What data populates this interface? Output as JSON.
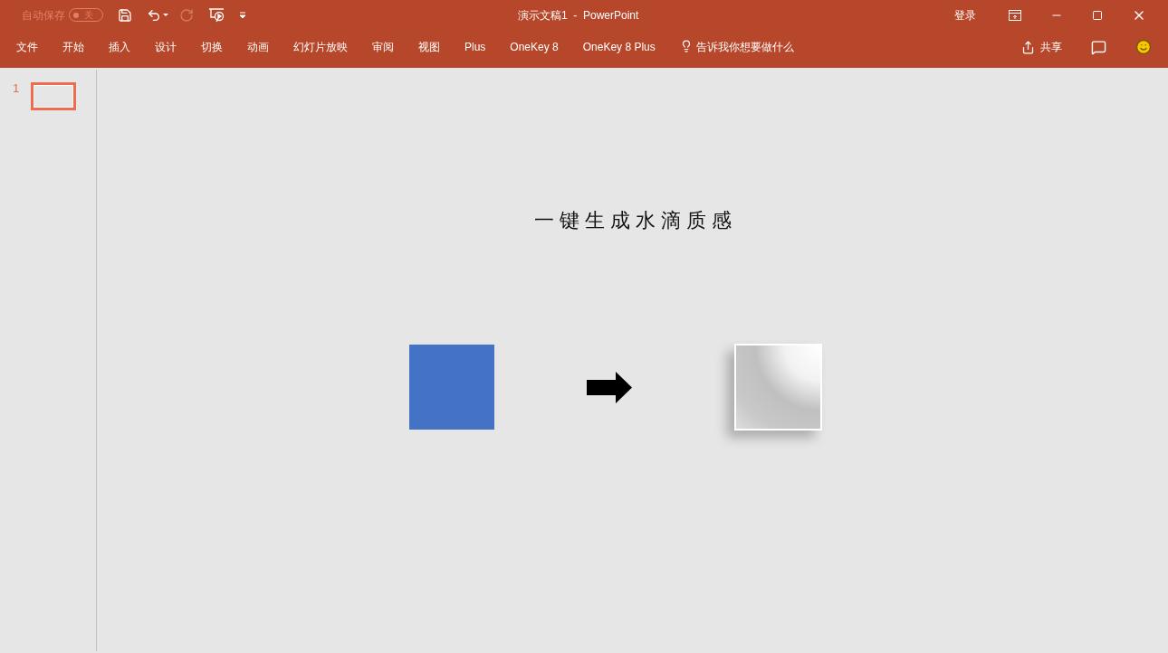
{
  "quick_access": {
    "autosave_label": "自动保存",
    "autosave_toggle": {
      "on": false,
      "label": "关"
    }
  },
  "window": {
    "title": "演示文稿1  -  PowerPoint",
    "sign_in": "登录"
  },
  "ribbon": {
    "tabs": [
      {
        "label": "文件",
        "selected": false
      },
      {
        "label": "开始",
        "selected": false
      },
      {
        "label": "插入",
        "selected": false
      },
      {
        "label": "设计",
        "selected": false
      },
      {
        "label": "切换",
        "selected": false
      },
      {
        "label": "动画",
        "selected": false
      },
      {
        "label": "幻灯片放映",
        "selected": false
      },
      {
        "label": "审阅",
        "selected": false
      },
      {
        "label": "视图",
        "selected": false
      },
      {
        "label": "Plus",
        "selected": false
      },
      {
        "label": "OneKey 8",
        "selected": false
      },
      {
        "label": "OneKey 8 Plus",
        "selected": false
      }
    ],
    "tell_me": "告诉我你想要做什么",
    "share": "共享"
  },
  "thumbnails": [
    {
      "number": "1",
      "selected": true
    }
  ],
  "slide": {
    "title": "一键生成水滴质感",
    "shapes": [
      {
        "kind": "square"
      },
      {
        "kind": "arrow"
      },
      {
        "kind": "droplet"
      }
    ]
  }
}
